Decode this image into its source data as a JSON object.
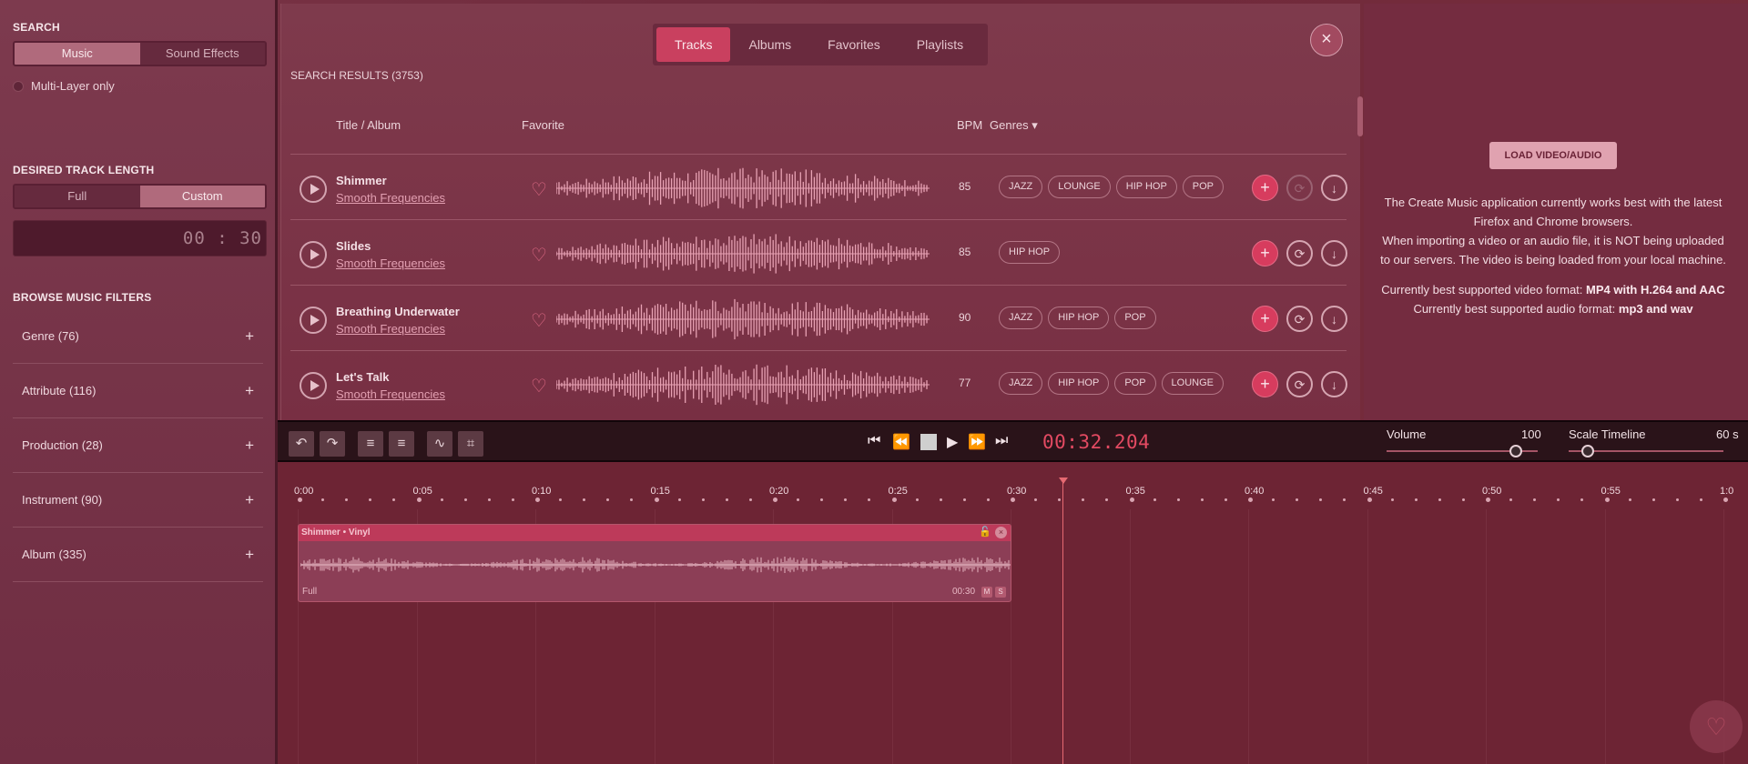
{
  "sidebar": {
    "search_title": "SEARCH",
    "search_modes": [
      "Music",
      "Sound Effects"
    ],
    "multilayer_label": "Multi-Layer only",
    "length_title": "DESIRED TRACK LENGTH",
    "length_modes": [
      "Full",
      "Custom"
    ],
    "custom_time": "00 : 30",
    "filters_title": "BROWSE MUSIC FILTERS",
    "filters": [
      {
        "label": "Genre (76)"
      },
      {
        "label": "Attribute (116)"
      },
      {
        "label": "Production (28)"
      },
      {
        "label": "Instrument (90)"
      },
      {
        "label": "Album (335)"
      }
    ],
    "plus": "+"
  },
  "tabs": [
    "Tracks",
    "Albums",
    "Favorites",
    "Playlists"
  ],
  "results_label": "SEARCH RESULTS (3753)",
  "columns": {
    "title": "Title / Album",
    "favorite": "Favorite",
    "bpm": "BPM",
    "genres": "Genres ▾"
  },
  "tracks": [
    {
      "title": "Shimmer",
      "album": "Smooth Frequencies",
      "bpm": "85",
      "tags": [
        "JAZZ",
        "LOUNGE",
        "HIP HOP",
        "POP"
      ]
    },
    {
      "title": "Slides",
      "album": "Smooth Frequencies",
      "bpm": "85",
      "tags": [
        "HIP HOP"
      ]
    },
    {
      "title": "Breathing Underwater",
      "album": "Smooth Frequencies",
      "bpm": "90",
      "tags": [
        "JAZZ",
        "HIP HOP",
        "POP"
      ]
    },
    {
      "title": "Let's Talk",
      "album": "Smooth Frequencies",
      "bpm": "77",
      "tags": [
        "JAZZ",
        "HIP HOP",
        "POP",
        "LOUNGE"
      ]
    }
  ],
  "info": {
    "load_button": "LOAD VIDEO/AUDIO",
    "line1": "The Create Music application currently works best with the latest Firefox and Chrome browsers.",
    "line2": "When importing a video or an audio file, it is NOT being uploaded to our servers. The video is being loaded from your local machine.",
    "video_prefix": "Currently best supported video format:",
    "video_format": "MP4 with H.264 and AAC",
    "audio_prefix": "Currently best supported audio format:",
    "audio_format": "mp3 and wav"
  },
  "transport": {
    "timecode": "00:32.204",
    "volume_label": "Volume",
    "volume_value": "100",
    "volume_level": 1.0,
    "scale_label": "Scale Timeline",
    "scale_value": "60 s",
    "scale_level": 0.1
  },
  "timeline": {
    "ticks": [
      "0:00",
      "0:05",
      "0:10",
      "0:15",
      "0:20",
      "0:25",
      "0:30",
      "0:35",
      "0:40",
      "0:45",
      "0:50",
      "0:55",
      "1:0"
    ],
    "clip_title": "Shimmer • Vinyl",
    "clip_length_mode": "Full",
    "clip_duration": "00:30",
    "clip_m": "M",
    "clip_s": "S"
  },
  "colors": {
    "accent": "#d73c5e",
    "timecode": "#e34a62",
    "playhead": "#e66a72"
  }
}
